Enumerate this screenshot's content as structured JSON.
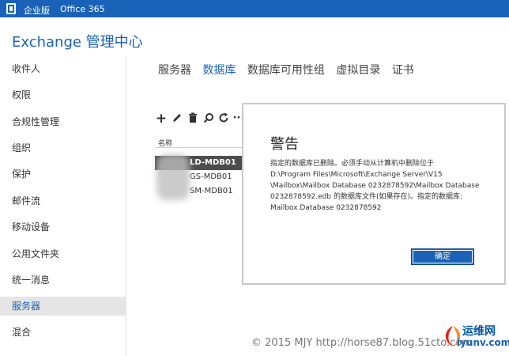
{
  "topbar": {
    "edition": "企业版",
    "product": "Office 365"
  },
  "app_title": "Exchange 管理中心",
  "sidebar": {
    "items": [
      {
        "label": "收件人",
        "active": false
      },
      {
        "label": "权限",
        "active": false
      },
      {
        "label": "合规性管理",
        "active": false
      },
      {
        "label": "组织",
        "active": false
      },
      {
        "label": "保护",
        "active": false
      },
      {
        "label": "邮件流",
        "active": false
      },
      {
        "label": "移动设备",
        "active": false
      },
      {
        "label": "公用文件夹",
        "active": false
      },
      {
        "label": "统一消息",
        "active": false
      },
      {
        "label": "服务器",
        "active": true
      },
      {
        "label": "混合",
        "active": false
      }
    ]
  },
  "tabs": [
    {
      "label": "服务器",
      "active": false
    },
    {
      "label": "数据库",
      "active": true
    },
    {
      "label": "数据库可用性组",
      "active": false
    },
    {
      "label": "虚拟目录",
      "active": false
    },
    {
      "label": "证书",
      "active": false
    }
  ],
  "toolbar": {
    "add_icon": "plus-icon",
    "edit_icon": "pencil-icon",
    "delete_icon": "trash-icon",
    "search_icon": "search-icon",
    "refresh_icon": "refresh-icon",
    "more_icon": "more-icon",
    "glyph_add": "+",
    "glyph_more": "···"
  },
  "table": {
    "column_name": "名称",
    "rows": [
      {
        "name": "LD-MDB01",
        "selected": true
      },
      {
        "name": "GS-MDB01",
        "selected": false
      },
      {
        "name": "SM-MDB01",
        "selected": false
      }
    ]
  },
  "dialog": {
    "title": "警告",
    "message_lines": [
      "指定的数据库已删除。必须手动从计算机中删除位于",
      "D:\\Program Files\\Microsoft\\Exchange Server\\V15",
      "\\Mailbox\\Mailbox Database 0232878592\\Mailbox Database",
      "0232878592.edb 的数据库文件(如果存在)。指定的数据库:",
      "Mailbox Database 0232878592"
    ],
    "ok_label": "确定"
  },
  "watermark": "© 2015 MJY http://horse87.blog.51cto.com",
  "brand": {
    "name": "运维网",
    "domain": "iyunv.com"
  },
  "colors": {
    "accent": "#1a62b8",
    "selected_row": "#4d4d4d",
    "nav_active_bg": "#e5e5e5"
  }
}
